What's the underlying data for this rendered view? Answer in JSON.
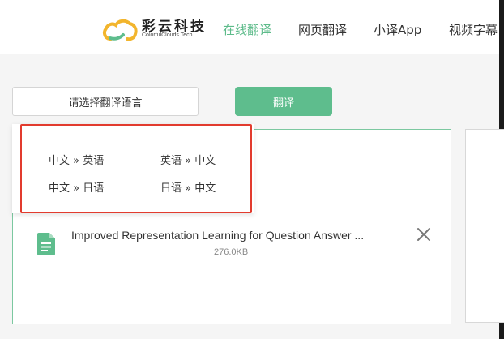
{
  "header": {
    "logo_cn": "彩云科技",
    "logo_en": "ColorfulClouds Tech.",
    "nav": [
      {
        "label": "在线翻译",
        "active": true
      },
      {
        "label": "网页翻译",
        "active": false
      },
      {
        "label": "小译App",
        "active": false
      },
      {
        "label": "视频字幕",
        "active": false
      }
    ]
  },
  "toolbar": {
    "language_select_label": "请选择翻译语言",
    "translate_button_label": "翻译"
  },
  "language_dropdown": {
    "options": [
      "中文 » 英语",
      "英语 » 中文",
      "中文 » 日语",
      "日语 » 中文"
    ]
  },
  "file": {
    "name": "Improved Representation Learning for Question Answer ...",
    "size": "276.0KB",
    "icon": "document-icon"
  },
  "colors": {
    "accent": "#5ebd8d",
    "highlight": "#e23b2e"
  }
}
